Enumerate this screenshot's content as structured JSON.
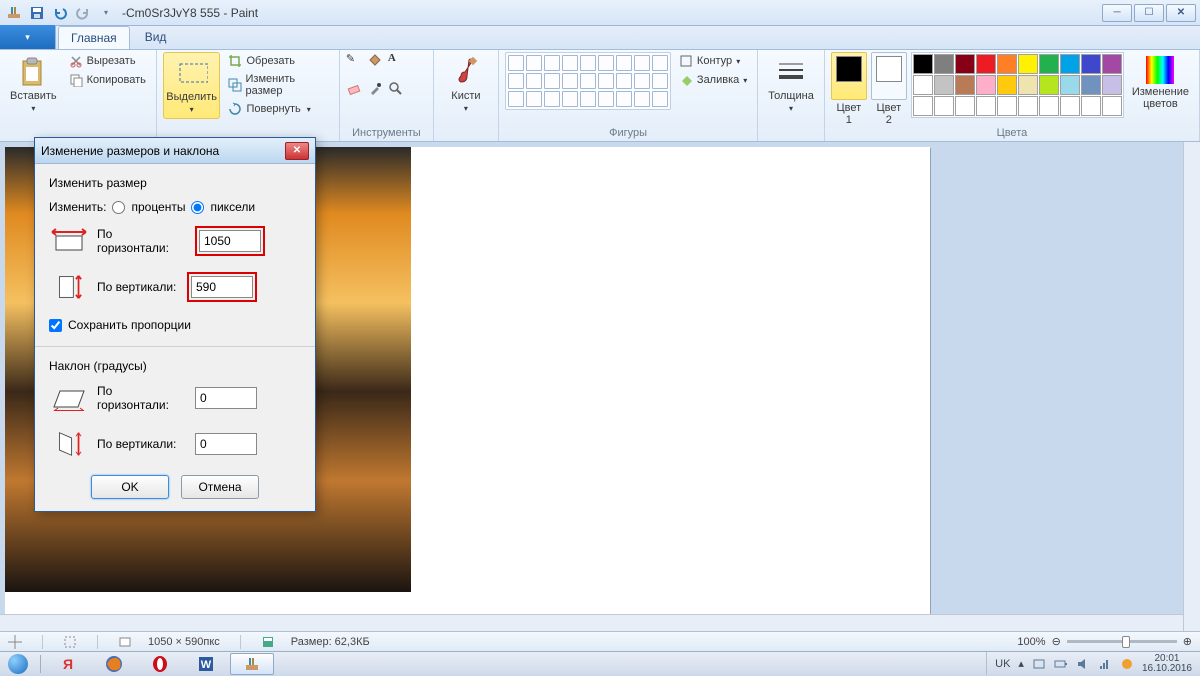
{
  "title": "-Cm0Sr3JvY8  555 - Paint",
  "tabs": {
    "file": "",
    "main": "Главная",
    "view": "Вид"
  },
  "ribbon": {
    "clipboard": {
      "paste": "Вставить",
      "cut": "Вырезать",
      "copy": "Копировать",
      "label": ""
    },
    "image": {
      "select": "Выделить",
      "crop": "Обрезать",
      "resize": "Изменить размер",
      "rotate": "Повернуть",
      "label": ""
    },
    "tools": {
      "label": "Инструменты"
    },
    "brushes": {
      "label": "Кисти"
    },
    "shapes": {
      "outline": "Контур",
      "fill": "Заливка",
      "label": "Фигуры"
    },
    "thickness": {
      "label": "Толщина"
    },
    "colors": {
      "c1": "Цвет\n1",
      "c2": "Цвет\n2",
      "edit": "Изменение\nцветов",
      "label": "Цвета"
    }
  },
  "palette": [
    "#000",
    "#7f7f7f",
    "#880015",
    "#ed1c24",
    "#ff7f27",
    "#fff200",
    "#22b14c",
    "#00a2e8",
    "#3f48cc",
    "#a349a4",
    "#fff",
    "#c3c3c3",
    "#b97a57",
    "#ffaec9",
    "#ffc90e",
    "#efe4b0",
    "#b5e61d",
    "#99d9ea",
    "#7092be",
    "#c8bfe7",
    "#fff",
    "#fff",
    "#fff",
    "#fff",
    "#fff",
    "#fff",
    "#fff",
    "#fff",
    "#fff",
    "#fff"
  ],
  "dialog": {
    "title": "Изменение размеров и наклона",
    "resize_section": "Изменить размер",
    "change_by": "Изменить:",
    "percent": "проценты",
    "pixels": "пиксели",
    "horiz": "По\nгоризонтали:",
    "vert": "По вертикали:",
    "h_val": "1050",
    "v_val": "590",
    "keep_ratio": "Сохранить пропорции",
    "skew_section": "Наклон (градусы)",
    "skew_h": "0",
    "skew_v": "0",
    "ok": "OK",
    "cancel": "Отмена"
  },
  "status": {
    "dims": "1050 × 590пкс",
    "size": "Размер: 62,3КБ",
    "zoom": "100%"
  },
  "taskbar": {
    "lang": "UK",
    "time": "20:01",
    "date": "16.10.2016"
  }
}
